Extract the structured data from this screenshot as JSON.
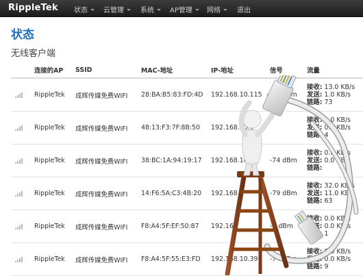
{
  "navbar": {
    "brand": "RippleTek",
    "menu": [
      {
        "label": "状态",
        "dropdown": true
      },
      {
        "label": "云管理",
        "dropdown": true
      },
      {
        "label": "系统",
        "dropdown": true
      },
      {
        "label": "AP管理",
        "dropdown": true
      },
      {
        "label": "网络",
        "dropdown": true
      },
      {
        "label": "退出",
        "dropdown": false
      }
    ]
  },
  "page": {
    "title": "状态",
    "section_title": "无线客户端"
  },
  "table": {
    "headers": {
      "ap": "连接的AP",
      "ssid": "SSID",
      "mac": "MAC-地址",
      "ip": "IP-地址",
      "signal": "信号",
      "traffic": "流量"
    },
    "labels": {
      "rx": "接收:",
      "tx": "发送:",
      "links": "链路:"
    },
    "rows": [
      {
        "ap": "RippleTek",
        "ssid": "成辉传媒免费WIFI",
        "mac": "28:BA:B5:83:FD:4D",
        "ip": "192.168.10.115",
        "signal": "-87 dBm",
        "rx": "13.0 KB/s",
        "tx": "1.0 KB/s",
        "links": "73"
      },
      {
        "ap": "RippleTek",
        "ssid": "成辉传媒免费WIFI",
        "mac": "48:13:F3:7F:8B:50",
        "ip": "192.168.10.9",
        "signal": "",
        "rx": "0.0 KB/s",
        "tx": "0.0 KB/s",
        "links": "4"
      },
      {
        "ap": "RippleTek",
        "ssid": "成辉传媒免费WIFI",
        "mac": "38:BC:1A:94:19:17",
        "ip": "192.168.10.",
        "signal": "-74 dBm",
        "rx": "0.0 KB/s",
        "tx": "0.0 KB/s",
        "links": ""
      },
      {
        "ap": "RippleTek",
        "ssid": "成辉传媒免费WIFI",
        "mac": "14:F6:5A:C3:4B:20",
        "ip": "192.168",
        "signal": "-79 dBm",
        "rx": "32.0 KB/s",
        "tx": "11.0 KB/s",
        "links": "63"
      },
      {
        "ap": "RippleTek",
        "ssid": "成辉传媒免费WIFI",
        "mac": "F8:A4:5F:EF:50:87",
        "ip": "192.16",
        "signal": "-7 dBm",
        "rx": "0.0 KB/s",
        "tx": "0.0 KB/s",
        "links": "1"
      },
      {
        "ap": "RippleTek",
        "ssid": "成辉传媒免费WIFI",
        "mac": "F8:A4:5F:55:E3:FD",
        "ip": "192.168.10.39",
        "signal": "-74 dBm",
        "rx": "0.0 KB/s",
        "tx": "0.0 KB/s",
        "links": "9"
      }
    ]
  },
  "colors": {
    "navbar": "#222222",
    "title": "#2070b8"
  },
  "icons": {
    "signal": "signal-strength-icon",
    "overlay": "figure-on-ladder-with-network-cable"
  }
}
